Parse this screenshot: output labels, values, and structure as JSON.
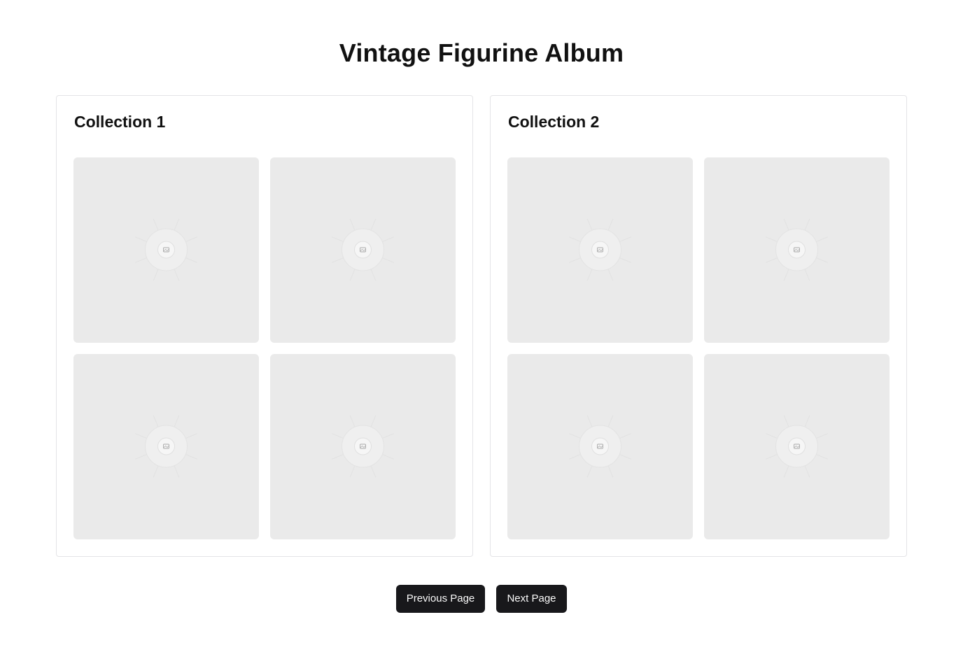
{
  "page": {
    "title": "Vintage Figurine Album"
  },
  "collections": [
    {
      "title": "Collection 1",
      "images": [
        {
          "icon": "image-placeholder-icon"
        },
        {
          "icon": "image-placeholder-icon"
        },
        {
          "icon": "image-placeholder-icon"
        },
        {
          "icon": "image-placeholder-icon"
        }
      ]
    },
    {
      "title": "Collection 2",
      "images": [
        {
          "icon": "image-placeholder-icon"
        },
        {
          "icon": "image-placeholder-icon"
        },
        {
          "icon": "image-placeholder-icon"
        },
        {
          "icon": "image-placeholder-icon"
        }
      ]
    }
  ],
  "pagination": {
    "previous_label": "Previous Page",
    "next_label": "Next Page"
  },
  "colors": {
    "button_bg": "#18181b",
    "button_text": "#fafafa",
    "tile_bg": "#eaeaea",
    "card_border": "#e4e4e7"
  }
}
